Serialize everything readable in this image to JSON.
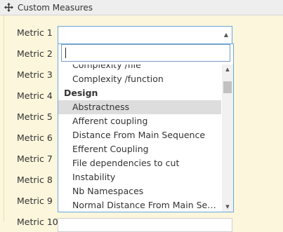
{
  "header": {
    "title": "Custom Measures",
    "icon": "move-icon"
  },
  "metrics": [
    {
      "label": "Metric 1"
    },
    {
      "label": "Metric 2"
    },
    {
      "label": "Metric 3"
    },
    {
      "label": "Metric 4"
    },
    {
      "label": "Metric 5"
    },
    {
      "label": "Metric 6"
    },
    {
      "label": "Metric 7"
    },
    {
      "label": "Metric 8"
    },
    {
      "label": "Metric 9"
    },
    {
      "label": "Metric 10"
    }
  ],
  "select": {
    "value": "",
    "caret": "▲"
  },
  "search": {
    "value": ""
  },
  "dropdown": {
    "items": [
      {
        "type": "item",
        "label": "Complexity /file"
      },
      {
        "type": "item",
        "label": "Complexity /function"
      },
      {
        "type": "group",
        "label": "Design"
      },
      {
        "type": "item",
        "label": "Abstractness",
        "selected": true
      },
      {
        "type": "item",
        "label": "Afferent coupling"
      },
      {
        "type": "item",
        "label": "Distance From Main Sequence"
      },
      {
        "type": "item",
        "label": "Efferent Coupling"
      },
      {
        "type": "item",
        "label": "File dependencies to cut"
      },
      {
        "type": "item",
        "label": "Instability"
      },
      {
        "type": "item",
        "label": "Nb Namespaces"
      },
      {
        "type": "item",
        "label": "Normal Distance From Main Sequence"
      }
    ]
  },
  "scrollbar": {
    "up": "▲",
    "down": "▼"
  }
}
